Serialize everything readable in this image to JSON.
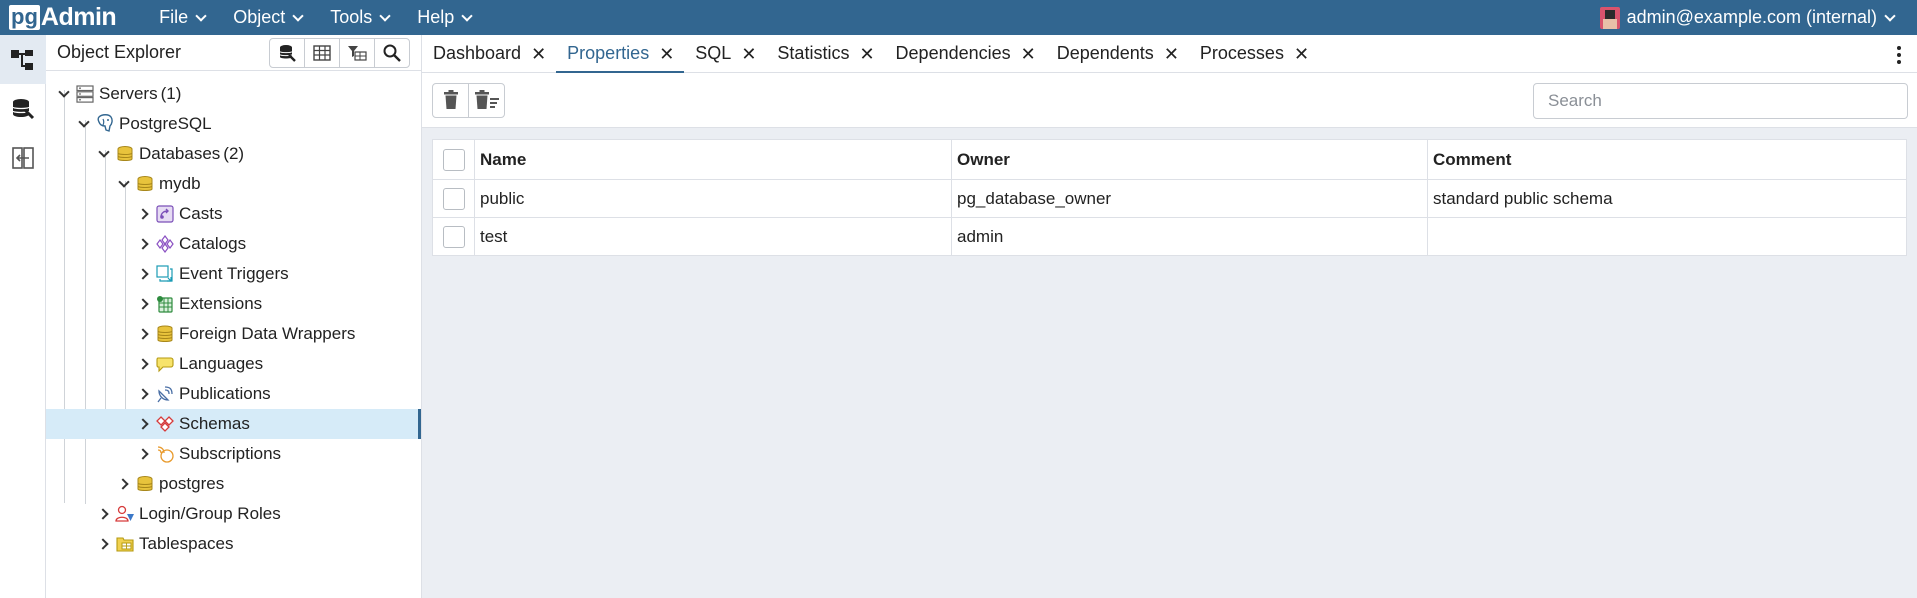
{
  "app": {
    "logo_pg": "pg",
    "logo_admin": "Admin"
  },
  "menubar": {
    "items": [
      {
        "label": "File"
      },
      {
        "label": "Object"
      },
      {
        "label": "Tools"
      },
      {
        "label": "Help"
      }
    ],
    "user": "admin@example.com (internal)"
  },
  "rail": {
    "icons": [
      "object-explorer-icon",
      "query-tool-icon",
      "schema-diff-icon"
    ]
  },
  "explorer": {
    "title": "Object Explorer",
    "tools": [
      "query-tool-icon",
      "view-data-icon",
      "filtered-rows-icon",
      "search-objects-icon"
    ],
    "tree": [
      {
        "label": "Servers",
        "count": "(1)",
        "icon": "servers-icon",
        "state": "expanded"
      },
      {
        "label": "PostgreSQL",
        "count": "",
        "icon": "postgresql-elephant-icon",
        "state": "expanded"
      },
      {
        "label": "Databases",
        "count": "(2)",
        "icon": "databases-icon",
        "state": "expanded"
      },
      {
        "label": "mydb",
        "count": "",
        "icon": "database-icon",
        "state": "expanded"
      },
      {
        "label": "Casts",
        "count": "",
        "icon": "casts-icon",
        "state": "collapsed"
      },
      {
        "label": "Catalogs",
        "count": "",
        "icon": "catalogs-icon",
        "state": "collapsed"
      },
      {
        "label": "Event Triggers",
        "count": "",
        "icon": "event-triggers-icon",
        "state": "collapsed"
      },
      {
        "label": "Extensions",
        "count": "",
        "icon": "extensions-icon",
        "state": "collapsed"
      },
      {
        "label": "Foreign Data Wrappers",
        "count": "",
        "icon": "foreign-data-wrappers-icon",
        "state": "collapsed"
      },
      {
        "label": "Languages",
        "count": "",
        "icon": "languages-icon",
        "state": "collapsed"
      },
      {
        "label": "Publications",
        "count": "",
        "icon": "publications-icon",
        "state": "collapsed"
      },
      {
        "label": "Schemas",
        "count": "",
        "icon": "schemas-icon",
        "state": "collapsed",
        "selected": true
      },
      {
        "label": "Subscriptions",
        "count": "",
        "icon": "subscriptions-icon",
        "state": "collapsed"
      },
      {
        "label": "postgres",
        "count": "",
        "icon": "database-icon",
        "state": "collapsed"
      },
      {
        "label": "Login/Group Roles",
        "count": "",
        "icon": "login-group-roles-icon",
        "state": "collapsed"
      },
      {
        "label": "Tablespaces",
        "count": "",
        "icon": "tablespaces-icon",
        "state": "collapsed"
      }
    ]
  },
  "tabs": [
    {
      "label": "Dashboard",
      "active": false
    },
    {
      "label": "Properties",
      "active": true
    },
    {
      "label": "SQL",
      "active": false
    },
    {
      "label": "Statistics",
      "active": false
    },
    {
      "label": "Dependencies",
      "active": false
    },
    {
      "label": "Dependents",
      "active": false
    },
    {
      "label": "Processes",
      "active": false
    }
  ],
  "toolbar": {
    "buttons": [
      "delete-icon",
      "delete-cascade-icon"
    ],
    "search_placeholder": "Search"
  },
  "grid": {
    "columns": [
      "Name",
      "Owner",
      "Comment"
    ],
    "rows": [
      [
        "public",
        "pg_database_owner",
        "standard public schema"
      ],
      [
        "test",
        "admin",
        ""
      ]
    ]
  },
  "colors": {
    "brand": "#326690",
    "selected_bg": "#d6ebf8",
    "panel_bg": "#ebeef3"
  }
}
